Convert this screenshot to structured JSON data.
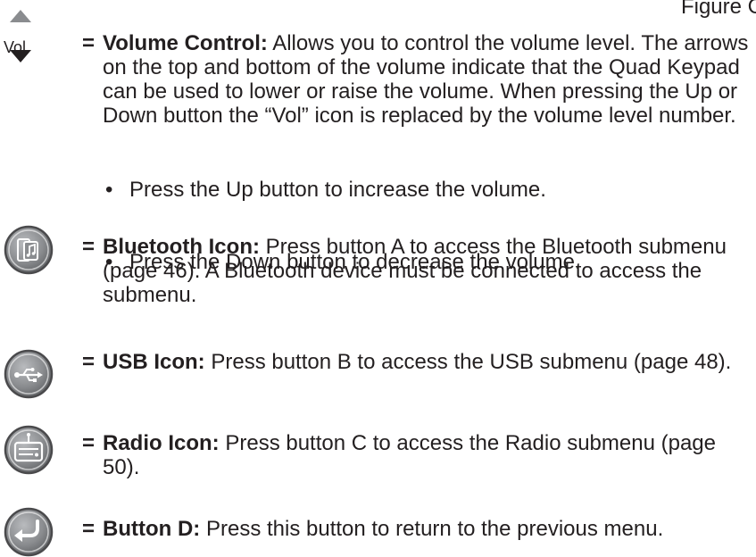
{
  "figure_label": "Figure C",
  "volume": {
    "icon_label": "Vol.",
    "equals": "=",
    "title": "Volume Control:",
    "text": " Allows you to control the volume level. The arrows on the top and bottom of the volume indicate that the Quad Keypad can be used to lower or raise the volume. When pressing the Up or Down button the “Vol” icon is replaced by the volume level number.",
    "bullets": [
      "Press the Up button to increase the volume.",
      "Press the Down button to decrease the volume."
    ],
    "bullet_char": "•"
  },
  "bluetooth": {
    "equals": "=",
    "title": "Bluetooth Icon:",
    "text": " Press button A to access the Bluetooth submenu (page 46). A Bluetooth device must be connected to access the submenu.",
    "icon": "bluetooth-phone-music-icon"
  },
  "usb": {
    "equals": "=",
    "title": "USB Icon:",
    "text": " Press button B to access the USB submenu (page 48).",
    "icon": "usb-icon"
  },
  "radio": {
    "equals": "=",
    "title": "Radio Icon:",
    "text": " Press button C to access the Radio submenu (page 50).",
    "icon": "radio-icon"
  },
  "button_d": {
    "equals": "=",
    "title": "Button D:",
    "text": " Press this button to return to the previous menu.",
    "icon": "return-arrow-icon"
  },
  "colors": {
    "text": "#231f20",
    "icon_gray": "#8a8c8f",
    "icon_dark": "#4a4a4c"
  }
}
